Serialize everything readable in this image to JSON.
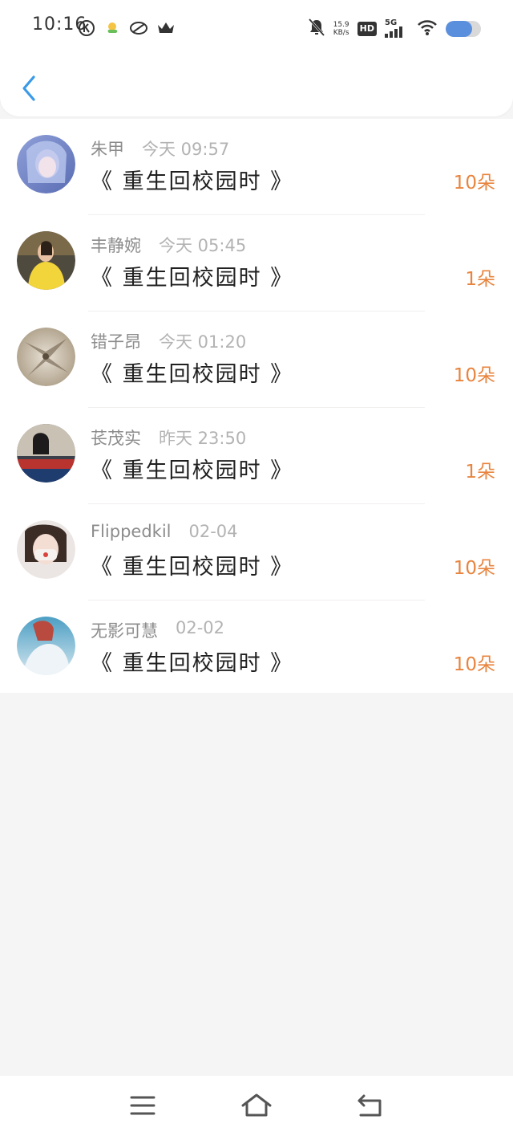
{
  "status_bar": {
    "time": "10:16",
    "net_speed_value": "15.9",
    "net_speed_unit": "KB/s",
    "hd_label": "HD",
    "network_label": "5G",
    "icons": [
      "k-circle-icon",
      "weather-icon",
      "app-icon",
      "crown-icon",
      "mute-bell-icon",
      "wifi-icon",
      "battery-icon"
    ],
    "battery_level": 0.75,
    "battery_color": "#5a8fde"
  },
  "nav": {
    "back_icon": "chevron-left-icon",
    "accent": "#3b9ae8"
  },
  "list": {
    "amount_color": "#e8843e",
    "items": [
      {
        "name": "朱甲",
        "time": "今天 09:57",
        "title": "《 重生回校园时 》",
        "amount": "10朵",
        "avatar": "avatar-image"
      },
      {
        "name": "丰静婉",
        "time": "今天 05:45",
        "title": "《 重生回校园时 》",
        "amount": "1朵",
        "avatar": "avatar-image"
      },
      {
        "name": "错子昂",
        "time": "今天 01:20",
        "title": "《 重生回校园时 》",
        "amount": "10朵",
        "avatar": "avatar-image"
      },
      {
        "name": "苌茂实",
        "time": "昨天 23:50",
        "title": "《 重生回校园时 》",
        "amount": "1朵",
        "avatar": "avatar-image"
      },
      {
        "name": "Flippedkil",
        "time": "02-04",
        "title": "《 重生回校园时 》",
        "amount": "10朵",
        "avatar": "avatar-image"
      },
      {
        "name": "无影可慧",
        "time": "02-02",
        "title": "《 重生回校园时 》",
        "amount": "10朵",
        "avatar": "avatar-image"
      }
    ]
  },
  "bottom_nav": {
    "icons": [
      "menu-icon",
      "home-icon",
      "back-icon"
    ]
  }
}
